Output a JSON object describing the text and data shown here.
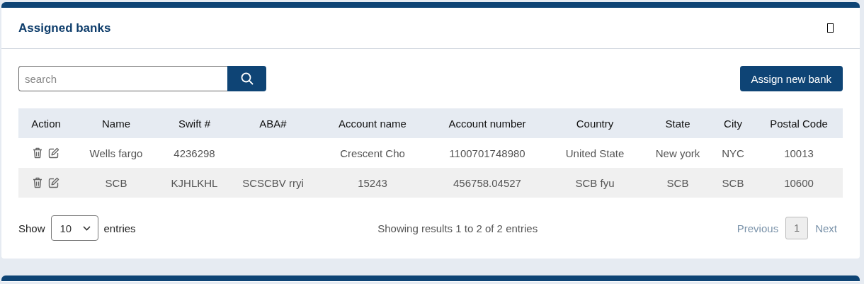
{
  "panel": {
    "title": "Assigned banks"
  },
  "search": {
    "placeholder": "search"
  },
  "assign_button": {
    "label": "Assign new bank"
  },
  "table": {
    "columns": [
      "Action",
      "Name",
      "Swift #",
      "ABA#",
      "Account name",
      "Account number",
      "Country",
      "State",
      "City",
      "Postal Code"
    ],
    "rows": [
      {
        "cells": [
          "",
          "Wells fargo",
          "4236298",
          "",
          "Crescent Cho",
          "1100701748980",
          "United State",
          "New york",
          "NYC",
          "10013"
        ]
      },
      {
        "cells": [
          "",
          "SCB",
          "KJHLKHL",
          "SCSCBV rryi",
          "15243",
          "456758.04527",
          "SCB fyu",
          "SCB",
          "SCB",
          "10600"
        ]
      }
    ]
  },
  "footer": {
    "show_label": "Show",
    "page_size": "10",
    "entries_label": "entries",
    "summary": "Showing results 1 to 2 of 2 entries",
    "previous": "Previous",
    "pages": [
      {
        "label": "1",
        "selected": true
      }
    ],
    "next": "Next"
  }
}
